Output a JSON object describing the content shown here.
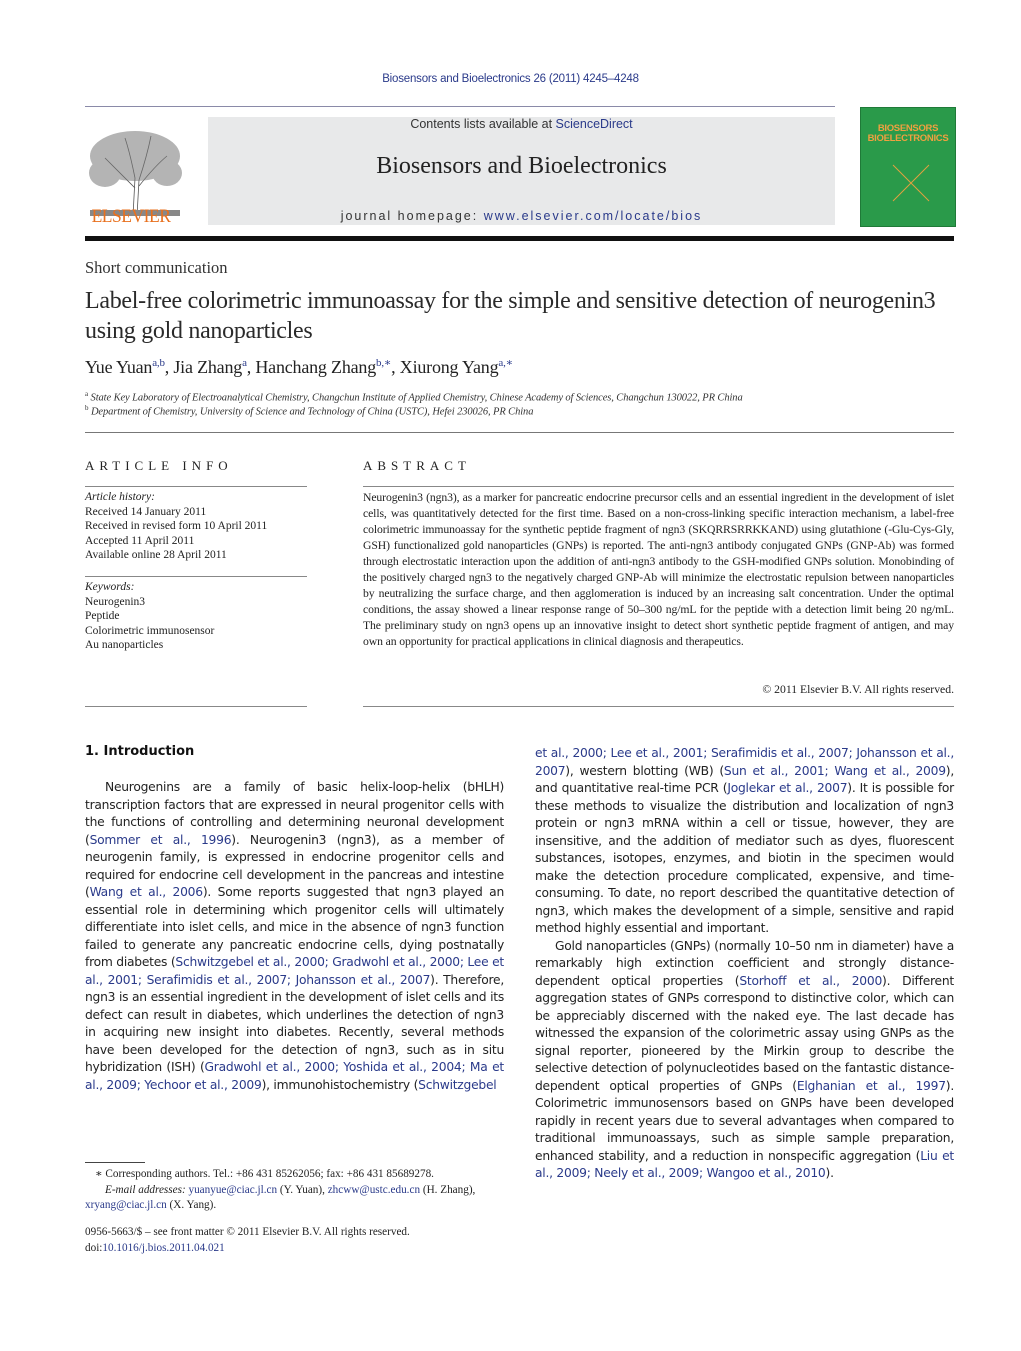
{
  "header": {
    "journal_ref": "Biosensors and Bioelectronics 26 (2011) 4245–4248",
    "contents_prefix": "Contents lists available at ",
    "contents_link": "ScienceDirect",
    "journal_title": "Biosensors and Bioelectronics",
    "homepage_prefix": "journal homepage: ",
    "homepage_link": "www.elsevier.com/locate/bios",
    "publisher_logo": "ELSEVIER",
    "cover_title_1": "BIOSENSORS",
    "cover_title_amp": "&",
    "cover_title_2": "BIOELECTRONICS"
  },
  "article": {
    "type": "Short communication",
    "title": "Label-free colorimetric immunoassay for the simple and sensitive detection of neurogenin3 using gold nanoparticles",
    "authors": [
      {
        "name": "Yue Yuan",
        "sup": "a,b",
        "sep": ", "
      },
      {
        "name": "Jia Zhang",
        "sup": "a",
        "sep": ", "
      },
      {
        "name": "Hanchang Zhang",
        "sup": "b,∗",
        "sep": ", "
      },
      {
        "name": "Xiurong Yang",
        "sup": "a,∗",
        "sep": ""
      }
    ],
    "affiliations": [
      {
        "mark": "a",
        "text": "State Key Laboratory of Electroanalytical Chemistry, Changchun Institute of Applied Chemistry, Chinese Academy of Sciences, Changchun 130022, PR China"
      },
      {
        "mark": "b",
        "text": "Department of Chemistry, University of Science and Technology of China (USTC), Hefei 230026, PR China"
      }
    ]
  },
  "article_info": {
    "heading": "ARTICLE INFO",
    "history_label": "Article history:",
    "history": [
      "Received 14 January 2011",
      "Received in revised form 10 April 2011",
      "Accepted 11 April 2011",
      "Available online 28 April 2011"
    ],
    "keywords_label": "Keywords:",
    "keywords": [
      "Neurogenin3",
      "Peptide",
      "Colorimetric immunosensor",
      "Au nanoparticles"
    ]
  },
  "abstract": {
    "heading": "ABSTRACT",
    "text": "Neurogenin3 (ngn3), as a marker for pancreatic endocrine precursor cells and an essential ingredient in the development of islet cells, was quantitatively detected for the first time. Based on a non-cross-linking specific interaction mechanism, a label-free colorimetric immunoassay for the synthetic peptide fragment of ngn3 (SKQRRSRRKKAND) using glutathione (-Glu-Cys-Gly, GSH) functionalized gold nanoparticles (GNPs) is reported. The anti-ngn3 antibody conjugated GNPs (GNP-Ab) was formed through electrostatic interaction upon the addition of anti-ngn3 antibody to the GSH-modified GNPs solution. Monobinding of the positively charged ngn3 to the negatively charged GNP-Ab will minimize the electrostatic repulsion between nanoparticles by neutralizing the surface charge, and then agglomeration is induced by an increasing salt concentration. Under the optimal conditions, the assay showed a linear response range of 50–300 ng/mL for the peptide with a detection limit being 20 ng/mL. The preliminary study on ngn3 opens up an innovative insight to detect short synthetic peptide fragment of antigen, and may own an opportunity for practical applications in clinical diagnosis and therapeutics.",
    "copyright": "© 2011 Elsevier B.V. All rights reserved."
  },
  "intro": {
    "heading": "1.  Introduction",
    "p1": [
      {
        "t": "Neurogenins are a family of basic helix-loop-helix (bHLH) transcription factors that are expressed in neural progenitor cells with the functions of controlling and determining neuronal development ("
      },
      {
        "l": "Sommer et al., 1996"
      },
      {
        "t": "). Neurogenin3 (ngn3), as a member of neurogenin family, is expressed in endocrine progenitor cells and required for endocrine cell development in the pancreas and intestine ("
      },
      {
        "l": "Wang et al., 2006"
      },
      {
        "t": "). Some reports suggested that ngn3 played an essential role in determining which progenitor cells will ultimately differentiate into islet cells, and mice in the absence of ngn3 function failed to generate any pancreatic endocrine cells, dying postnatally from diabetes ("
      },
      {
        "l": "Schwitzgebel et al., 2000; Gradwohl et al., 2000; Lee et al., 2001; Serafimidis et al., 2007; Johansson et al., 2007"
      },
      {
        "t": "). Therefore, ngn3 is an essential ingredient in the development of islet cells and its defect can result in diabetes, which underlines the detection of ngn3 in acquiring new insight into diabetes. Recently, several methods have been developed for the detection of ngn3, such as in situ hybridization (ISH) ("
      },
      {
        "l": "Gradwohl et al., 2000; Yoshida et al., 2004; Ma et al., 2009; Yechoor et al., 2009"
      },
      {
        "t": "), immunohistochemistry ("
      },
      {
        "l": "Schwitzgebel"
      }
    ],
    "p1_cont": [
      {
        "l": "et al., 2000; Lee et al., 2001; Serafimidis et al., 2007; Johansson et al., 2007"
      },
      {
        "t": "), western blotting (WB) ("
      },
      {
        "l": "Sun et al., 2001; Wang et al., 2009"
      },
      {
        "t": "), and quantitative real-time PCR ("
      },
      {
        "l": "Joglekar et al., 2007"
      },
      {
        "t": "). It is possible for these methods to visualize the distribution and localization of ngn3 protein or ngn3 mRNA within a cell or tissue, however, they are insensitive, and the addition of mediator such as dyes, fluorescent substances, isotopes, enzymes, and biotin in the specimen would make the detection procedure complicated, expensive, and time-consuming. To date, no report described the quantitative detection of ngn3, which makes the development of a simple, sensitive and rapid method highly essential and important."
      }
    ],
    "p2": [
      {
        "t": "Gold nanoparticles (GNPs) (normally 10–50 nm in diameter) have a remarkably high extinction coefficient and strongly distance-dependent optical properties ("
      },
      {
        "l": "Storhoff et al., 2000"
      },
      {
        "t": "). Different aggregation states of GNPs correspond to distinctive color, which can be appreciably discerned with the naked eye. The last decade has witnessed the expansion of the colorimetric assay using GNPs as the signal reporter, pioneered by the Mirkin group to describe the selective detection of polynucleotides based on the fantastic distance-dependent optical properties of GNPs ("
      },
      {
        "l": "Elghanian et al., 1997"
      },
      {
        "t": "). Colorimetric immunosensors based on GNPs have been developed rapidly in recent years due to several advantages when compared to traditional immunoassays, such as simple sample preparation, enhanced stability, and a reduction in nonspecific aggregation ("
      },
      {
        "l": "Liu et al., 2009; Neely et al., 2009; Wangoo et al., 2010"
      },
      {
        "t": ")."
      }
    ]
  },
  "footnotes": {
    "corresponding": "∗ Corresponding authors. Tel.: +86 431 85262056; fax: +86 431 85689278.",
    "email_label": "E-mail addresses: ",
    "emails": [
      {
        "addr": "yuanyue@ciac.jl.cn",
        "who": " (Y. Yuan), "
      },
      {
        "addr": "zhcww@ustc.edu.cn",
        "who": " (H. Zhang), "
      },
      {
        "addr": "xryang@ciac.jl.cn",
        "who": " (X. Yang)."
      }
    ],
    "issn": "0956-5663/$ – see front matter © 2011 Elsevier B.V. All rights reserved.",
    "doi_prefix": "doi:",
    "doi": "10.1016/j.bios.2011.04.021"
  },
  "colors": {
    "link": "#2a3a8a",
    "elsevier_orange": "#e8701e",
    "cover_green": "#2a9a4a"
  }
}
